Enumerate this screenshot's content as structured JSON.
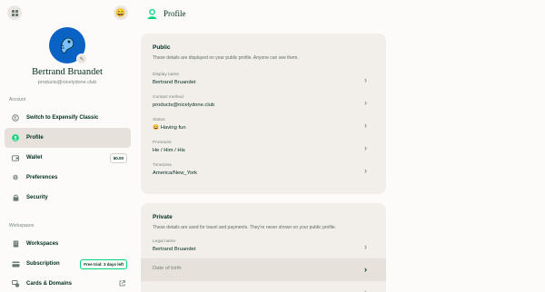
{
  "sidebar": {
    "home_icon": "grid-icon",
    "status_emoji": "😀",
    "user": {
      "name": "Bertrand Bruandet",
      "email": "products@nicelydone.club"
    },
    "account_section_label": "Account",
    "account_items": [
      {
        "label": "Switch to Expensify Classic",
        "icon": "expensify-icon"
      },
      {
        "label": "Profile",
        "icon": "profile-icon",
        "active": true
      },
      {
        "label": "Wallet",
        "icon": "wallet-icon",
        "badge": "$0.00"
      },
      {
        "label": "Preferences",
        "icon": "gear-icon"
      },
      {
        "label": "Security",
        "icon": "lock-icon"
      }
    ],
    "workspaces_section_label": "Workspaces",
    "workspace_items": [
      {
        "label": "Workspaces",
        "icon": "building-icon"
      },
      {
        "label": "Subscription",
        "icon": "credit-card-icon",
        "badge": "Free trial: 3 days left"
      },
      {
        "label": "Cards & Domains",
        "icon": "cards-icon"
      }
    ]
  },
  "header": {
    "title": "Profile",
    "icon": "profile-icon"
  },
  "public_card": {
    "title": "Public",
    "description": "These details are displayed on your public profile. Anyone can see them.",
    "rows": [
      {
        "label": "Display name",
        "value": "Bertrand Bruandet"
      },
      {
        "label": "Contact method",
        "value": "products@nicelydone.club"
      },
      {
        "label": "Status",
        "value": "😀 Having fun"
      },
      {
        "label": "Pronouns",
        "value": "He / Him / His"
      },
      {
        "label": "Timezone",
        "value": "America/New_York"
      }
    ]
  },
  "private_card": {
    "title": "Private",
    "description": "These details are used for travel and payments. They're never shown on your public profile.",
    "rows": [
      {
        "label": "Legal name",
        "value": "Bertrand Bruandet"
      },
      {
        "label": "Date of birth",
        "value": ""
      }
    ]
  },
  "colors": {
    "accent": "#03d47c",
    "text": "#002e22",
    "muted": "#76847e",
    "card": "#f2eee9",
    "background": "#fcfbf9"
  }
}
